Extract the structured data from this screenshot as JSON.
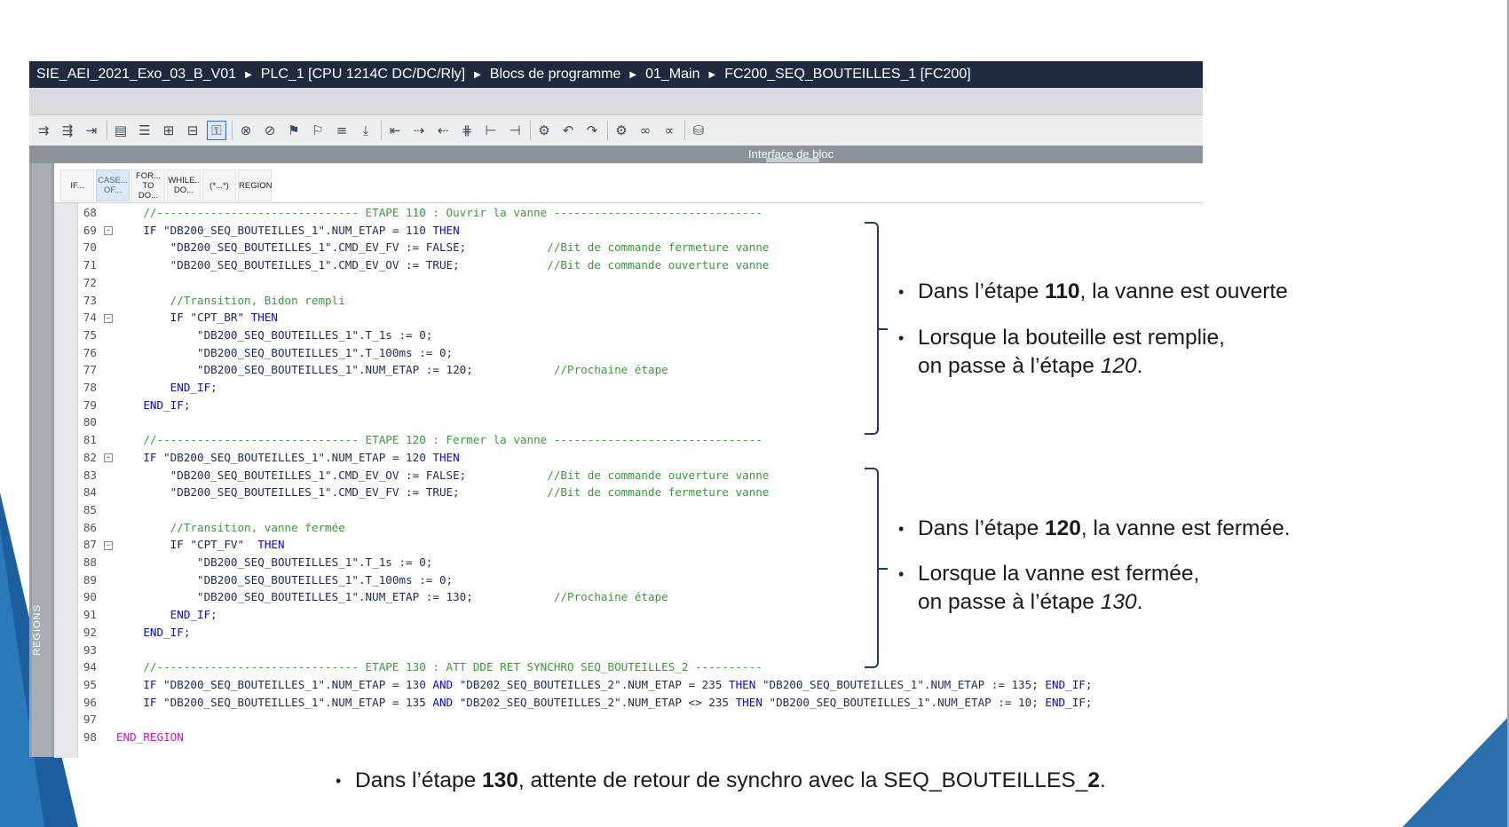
{
  "window": {
    "breadcrumb": [
      "SIE_AEI_2021_Exo_03_B_V01",
      "PLC_1 [CPU 1214C DC/DC/Rly]",
      "Blocs de programme",
      "01_Main",
      "FC200_SEQ_BOUTEILLES_1 [FC200]"
    ]
  },
  "interface_bar": {
    "label": "Interface de bloc"
  },
  "side_panel": {
    "label": "REGIONS"
  },
  "statement_buttons": [
    {
      "line1": "IF...",
      "line2": ""
    },
    {
      "line1": "CASE...",
      "line2": "OF..."
    },
    {
      "line1": "FOR...",
      "line2": "TO DO..."
    },
    {
      "line1": "WHILE..",
      "line2": "DO..."
    },
    {
      "line1": "(*...*)",
      "line2": ""
    },
    {
      "line1": "REGION",
      "line2": ""
    }
  ],
  "code_lines": [
    {
      "n": "68",
      "fold": false,
      "text": "    //------------------------------ ETAPE 110 : Ouvrir la vanne -------------------------------",
      "cls": "cm"
    },
    {
      "n": "69",
      "fold": true,
      "text": "    IF \"DB200_SEQ_BOUTEILLES_1\".NUM_ETAP = 110 THEN",
      "cls": "kw"
    },
    {
      "n": "70",
      "fold": false,
      "text": "        \"DB200_SEQ_BOUTEILLES_1\".CMD_EV_FV := FALSE;            //Bit de commande fermeture vanne",
      "cls": "mix"
    },
    {
      "n": "71",
      "fold": false,
      "text": "        \"DB200_SEQ_BOUTEILLES_1\".CMD_EV_OV := TRUE;             //Bit de commande ouverture vanne",
      "cls": "mix"
    },
    {
      "n": "72",
      "fold": false,
      "text": "",
      "cls": "str"
    },
    {
      "n": "73",
      "fold": false,
      "text": "        //Transition, Bidon rempli",
      "cls": "cm"
    },
    {
      "n": "74",
      "fold": true,
      "text": "        IF \"CPT_BR\" THEN",
      "cls": "kw"
    },
    {
      "n": "75",
      "fold": false,
      "text": "            \"DB200_SEQ_BOUTEILLES_1\".T_1s := 0;",
      "cls": "str"
    },
    {
      "n": "76",
      "fold": false,
      "text": "            \"DB200_SEQ_BOUTEILLES_1\".T_100ms := 0;",
      "cls": "str"
    },
    {
      "n": "77",
      "fold": false,
      "text": "            \"DB200_SEQ_BOUTEILLES_1\".NUM_ETAP := 120;            //Prochaine étape",
      "cls": "mix"
    },
    {
      "n": "78",
      "fold": false,
      "text": "        END_IF;",
      "cls": "kw"
    },
    {
      "n": "79",
      "fold": false,
      "text": "    END_IF;",
      "cls": "kw"
    },
    {
      "n": "80",
      "fold": false,
      "text": "",
      "cls": "str"
    },
    {
      "n": "81",
      "fold": false,
      "text": "    //------------------------------ ETAPE 120 : Fermer la vanne -------------------------------",
      "cls": "cm"
    },
    {
      "n": "82",
      "fold": true,
      "text": "    IF \"DB200_SEQ_BOUTEILLES_1\".NUM_ETAP = 120 THEN",
      "cls": "kw"
    },
    {
      "n": "83",
      "fold": false,
      "text": "        \"DB200_SEQ_BOUTEILLES_1\".CMD_EV_OV := FALSE;            //Bit de commande ouverture vanne",
      "cls": "mix"
    },
    {
      "n": "84",
      "fold": false,
      "text": "        \"DB200_SEQ_BOUTEILLES_1\".CMD_EV_FV := TRUE;             //Bit de commande fermeture vanne",
      "cls": "mix"
    },
    {
      "n": "85",
      "fold": false,
      "text": "",
      "cls": "str"
    },
    {
      "n": "86",
      "fold": false,
      "text": "        //Transition, vanne fermée",
      "cls": "cm"
    },
    {
      "n": "87",
      "fold": true,
      "text": "        IF \"CPT_FV\"  THEN",
      "cls": "kw"
    },
    {
      "n": "88",
      "fold": false,
      "text": "            \"DB200_SEQ_BOUTEILLES_1\".T_1s := 0;",
      "cls": "str"
    },
    {
      "n": "89",
      "fold": false,
      "text": "            \"DB200_SEQ_BOUTEILLES_1\".T_100ms := 0;",
      "cls": "str"
    },
    {
      "n": "90",
      "fold": false,
      "text": "            \"DB200_SEQ_BOUTEILLES_1\".NUM_ETAP := 130;            //Prochaine étape",
      "cls": "mix"
    },
    {
      "n": "91",
      "fold": false,
      "text": "        END_IF;",
      "cls": "kw"
    },
    {
      "n": "92",
      "fold": false,
      "text": "    END_IF;",
      "cls": "kw"
    },
    {
      "n": "93",
      "fold": false,
      "text": "",
      "cls": "str"
    },
    {
      "n": "94",
      "fold": false,
      "text": "    //------------------------------ ETAPE 130 : ATT DDE RET SYNCHRO SEQ_BOUTEILLES_2 ----------",
      "cls": "cm"
    },
    {
      "n": "95",
      "fold": false,
      "text": "    IF \"DB200_SEQ_BOUTEILLES_1\".NUM_ETAP = 130 AND \"DB202_SEQ_BOUTEILLES_2\".NUM_ETAP = 235 THEN \"DB200_SEQ_BOUTEILLES_1\".NUM_ETAP := 135; END_IF;",
      "cls": "kw"
    },
    {
      "n": "96",
      "fold": false,
      "text": "    IF \"DB200_SEQ_BOUTEILLES_1\".NUM_ETAP = 135 AND \"DB202_SEQ_BOUTEILLES_2\".NUM_ETAP <> 235 THEN \"DB200_SEQ_BOUTEILLES_1\".NUM_ETAP := 10; END_IF;",
      "cls": "kw"
    },
    {
      "n": "97",
      "fold": false,
      "text": "",
      "cls": "str"
    },
    {
      "n": "98",
      "fold": false,
      "text": "END_REGION",
      "cls": "reg"
    }
  ],
  "annotations": {
    "step110_a": {
      "pre": "Dans l’étape ",
      "bold": "110",
      "post": ", la vanne est ouverte"
    },
    "step110_b": {
      "line1": "Lorsque la bouteille est remplie,",
      "line2_pre": "on passe à l’étape ",
      "line2_it": "120",
      "line2_post": "."
    },
    "step120_a": {
      "pre": "Dans l’étape ",
      "bold": "120",
      "post": ", la vanne est fermée."
    },
    "step120_b": {
      "line1": "Lorsque la vanne est fermée,",
      "line2_pre": "on passe à l’étape ",
      "line2_it": "130",
      "line2_post": "."
    },
    "step130": {
      "pre": "Dans l’étape ",
      "bold": "130",
      "mid": ", attente de retour de synchro avec la SEQ_BOUTEILLES_",
      "bold2": "2",
      "post": "."
    }
  },
  "colors": {
    "title_bg": "#1e2b3e",
    "accent_blue": "#1d5f9e",
    "keyword": "#0c0cd6",
    "comment": "#3c9a3c",
    "region": "#c01ac0"
  }
}
